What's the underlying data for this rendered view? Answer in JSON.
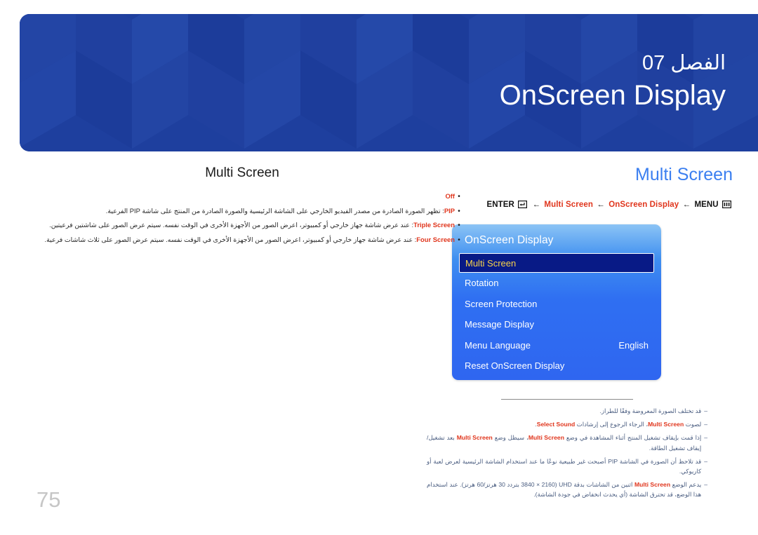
{
  "banner": {
    "chapter_label": "الفصل 07",
    "chapter_title": "OnScreen Display",
    "bg_color": "#1e3f9e"
  },
  "page": {
    "number": "75"
  },
  "right_column": {
    "section_title": "Multi Screen",
    "section_title_color": "#3b7ff0",
    "breadcrumb": {
      "enter_label": "ENTER",
      "enter_icon": "enter-key-icon",
      "arrow": "←",
      "step_1": "Multi Screen",
      "step_2": "OnScreen Display",
      "menu_label": "MENU",
      "menu_icon": "menu-grid-icon",
      "highlight_color": "#e0351c"
    },
    "osd": {
      "title": "OnScreen Display",
      "selected_item": "Multi Screen",
      "selected_text_color": "#f7d24a",
      "selected_bg_color": "#081a86",
      "items": [
        {
          "label": "Multi Screen",
          "value": "",
          "selected": true
        },
        {
          "label": "Rotation",
          "value": "",
          "selected": false
        },
        {
          "label": "Screen Protection",
          "value": "",
          "selected": false
        },
        {
          "label": "Message Display",
          "value": "",
          "selected": false
        },
        {
          "label": "Menu Language",
          "value": "English",
          "selected": false
        },
        {
          "label": "Reset OnScreen Display",
          "value": "",
          "selected": false
        }
      ]
    },
    "notes": [
      {
        "dash": "‒",
        "text": "قد تختلف الصورة المعروضة وفقًا للطراز."
      },
      {
        "dash": "‒",
        "prefix": "لصوت ",
        "bold_1": "Multi Screen",
        "middle": "، الرجاء الرجوع إلى إرشادات ",
        "bold_2": "Select Sound",
        "suffix": "."
      },
      {
        "dash": "‒",
        "prefix": "إذا قمت بإيقاف تشغيل المنتج أثناء المشاهدة في وضع ",
        "bold_1": "Multi Screen",
        "middle": "، سيظل وضع ",
        "bold_2": "Multi Screen",
        "suffix": " بعد تشغيل/إيقاف تشغيل الطاقة."
      },
      {
        "dash": "‒",
        "text": "قد تلاحظ أن الصورة في الشاشة PIP أصبحت غير طبيعية نوعًا ما عند استخدام الشاشة الرئيسية لعرض لعبة أو كاريوكي."
      },
      {
        "dash": "‒",
        "prefix": "يدعم الوضع ",
        "bold_1": "Multi Screen",
        "suffix": " اثنين من الشاشات بدقة UHD (3840 × 2160 بتردد 30 هرتز/60 هرتز). عند استخدام هذا الوضع، قد تحترق الشاشة (أي يحدث انخفاض في جودة الشاشة)."
      }
    ]
  },
  "left_column": {
    "section_title": "Multi Screen",
    "bullets": [
      {
        "dot": "•",
        "term": "Off",
        "text": ""
      },
      {
        "dot": "•",
        "term": "PIP",
        "text": ": تظهر الصورة الصادرة من مصدر الفيديو الخارجي على الشاشة الرئيسية والصورة الصادرة من المنتج على شاشة PIP الفرعية."
      },
      {
        "dot": "•",
        "term": "Triple Screen",
        "text": ": عند عرض شاشة جهاز خارجي أو كمبيوتر، اعرض الصور من الأجهزة الأخرى في الوقت نفسه. سيتم عرض الصور على شاشتين فرعيتين."
      },
      {
        "dot": "•",
        "term": "Four Screen",
        "text": ": عند عرض شاشة جهاز خارجي أو كمبيوتر، اعرض الصور من الأجهزة الأخرى في الوقت نفسه. سيتم عرض الصور على ثلاث شاشات فرعية."
      }
    ]
  }
}
